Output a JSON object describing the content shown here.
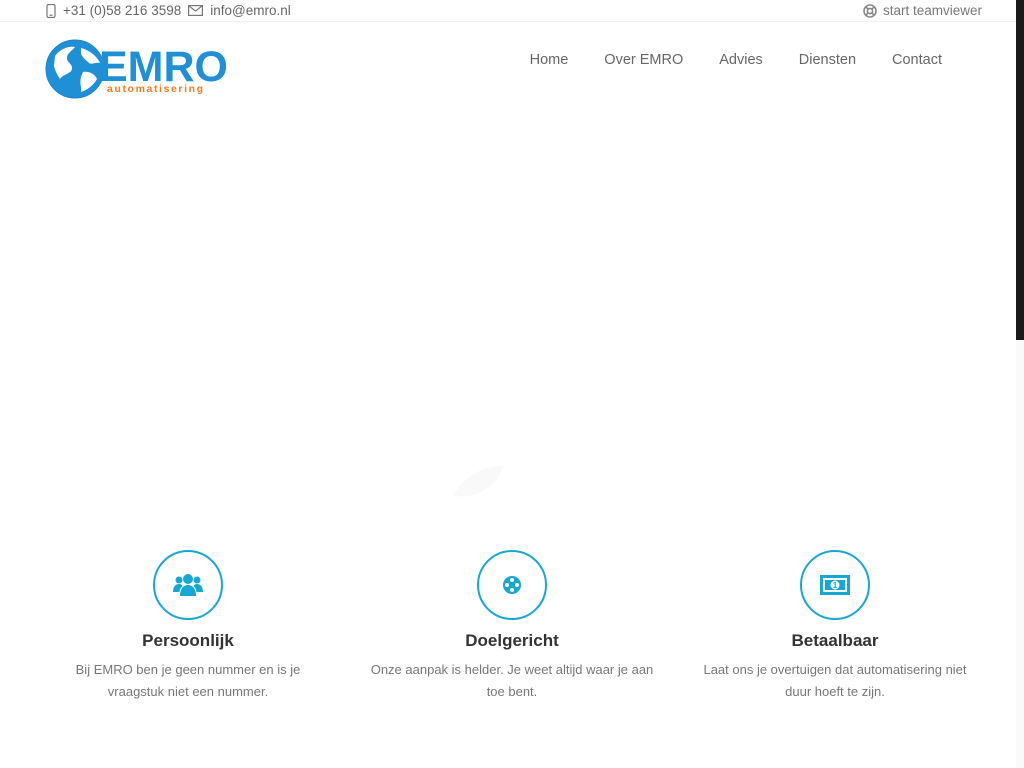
{
  "topbar": {
    "phone_icon": "mobile-phone-icon",
    "phone": "+31 (0)58 216 3598",
    "email_icon": "envelope-icon",
    "email": "info@emro.nl",
    "teamviewer_icon": "lifebuoy-icon",
    "teamviewer_label": "start teamviewer"
  },
  "logo": {
    "title": "EMRO",
    "subtitle": "automatisering",
    "icon": "globe-icon",
    "colors": {
      "primary": "#1f8fd6",
      "accent": "#f07c1b"
    }
  },
  "nav": {
    "items": [
      {
        "label": "Home"
      },
      {
        "label": "Over EMRO"
      },
      {
        "label": "Advies"
      },
      {
        "label": "Diensten"
      },
      {
        "label": "Contact"
      }
    ]
  },
  "features": [
    {
      "icon": "users-icon",
      "title": "Persoonlijk",
      "text": "Bij EMRO ben je geen nummer en is je vraagstuk niet een nummer."
    },
    {
      "icon": "target-icon",
      "title": "Doelgericht",
      "text": "Onze aanpak is helder. Je weet altijd waar je aan toe bent."
    },
    {
      "icon": "money-icon",
      "title": "Betaalbaar",
      "text": "Laat ons je overtuigen dat automatisering niet duur hoeft te zijn."
    }
  ],
  "theme": {
    "accent": "#16a7d3"
  }
}
